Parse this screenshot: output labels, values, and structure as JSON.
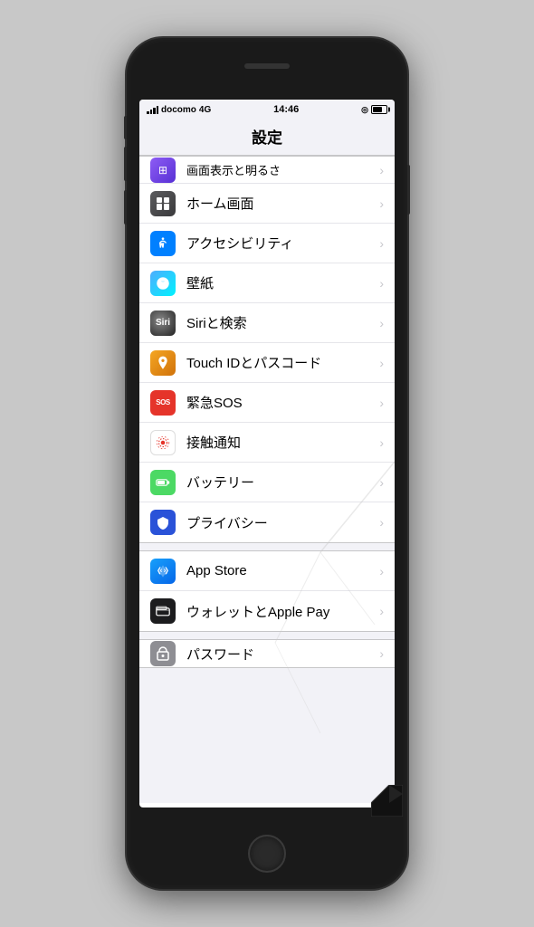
{
  "phone": {
    "status_bar": {
      "carrier": "docomo",
      "network": "4G",
      "time": "14:46",
      "battery_percent": 75
    },
    "header": {
      "title": "設定"
    },
    "settings_items": [
      {
        "id": "home-screen",
        "label": "ホーム画面",
        "icon_class": "icon-home",
        "icon_symbol": "⊞"
      },
      {
        "id": "accessibility",
        "label": "アクセシビリティ",
        "icon_class": "icon-accessibility",
        "icon_symbol": "♿"
      },
      {
        "id": "wallpaper",
        "label": "壁紙",
        "icon_class": "icon-wallpaper",
        "icon_symbol": "❋"
      },
      {
        "id": "siri",
        "label": "Siriと検索",
        "icon_class": "icon-siri",
        "icon_symbol": "◉"
      },
      {
        "id": "touchid",
        "label": "Touch IDとパスコード",
        "icon_class": "icon-touchid",
        "icon_symbol": "⊙"
      },
      {
        "id": "sos",
        "label": "緊急SOS",
        "icon_class": "icon-sos",
        "icon_symbol": "SOS"
      },
      {
        "id": "exposure",
        "label": "接触通知",
        "icon_class": "icon-exposure",
        "icon_symbol": "❋"
      },
      {
        "id": "battery",
        "label": "バッテリー",
        "icon_class": "icon-battery",
        "icon_symbol": "▬"
      },
      {
        "id": "privacy",
        "label": "プライバシー",
        "icon_class": "icon-privacy",
        "icon_symbol": "✋"
      }
    ],
    "section2_items": [
      {
        "id": "appstore",
        "label": "App Store",
        "icon_class": "icon-appstore",
        "icon_symbol": "A"
      },
      {
        "id": "wallet",
        "label": "ウォレットとApple Pay",
        "icon_class": "icon-wallet",
        "icon_symbol": "▣"
      }
    ],
    "section3_items": [
      {
        "id": "passcode",
        "label": "パスワード",
        "icon_class": "icon-passcode",
        "icon_symbol": "🔑"
      }
    ],
    "chevron": "›"
  }
}
